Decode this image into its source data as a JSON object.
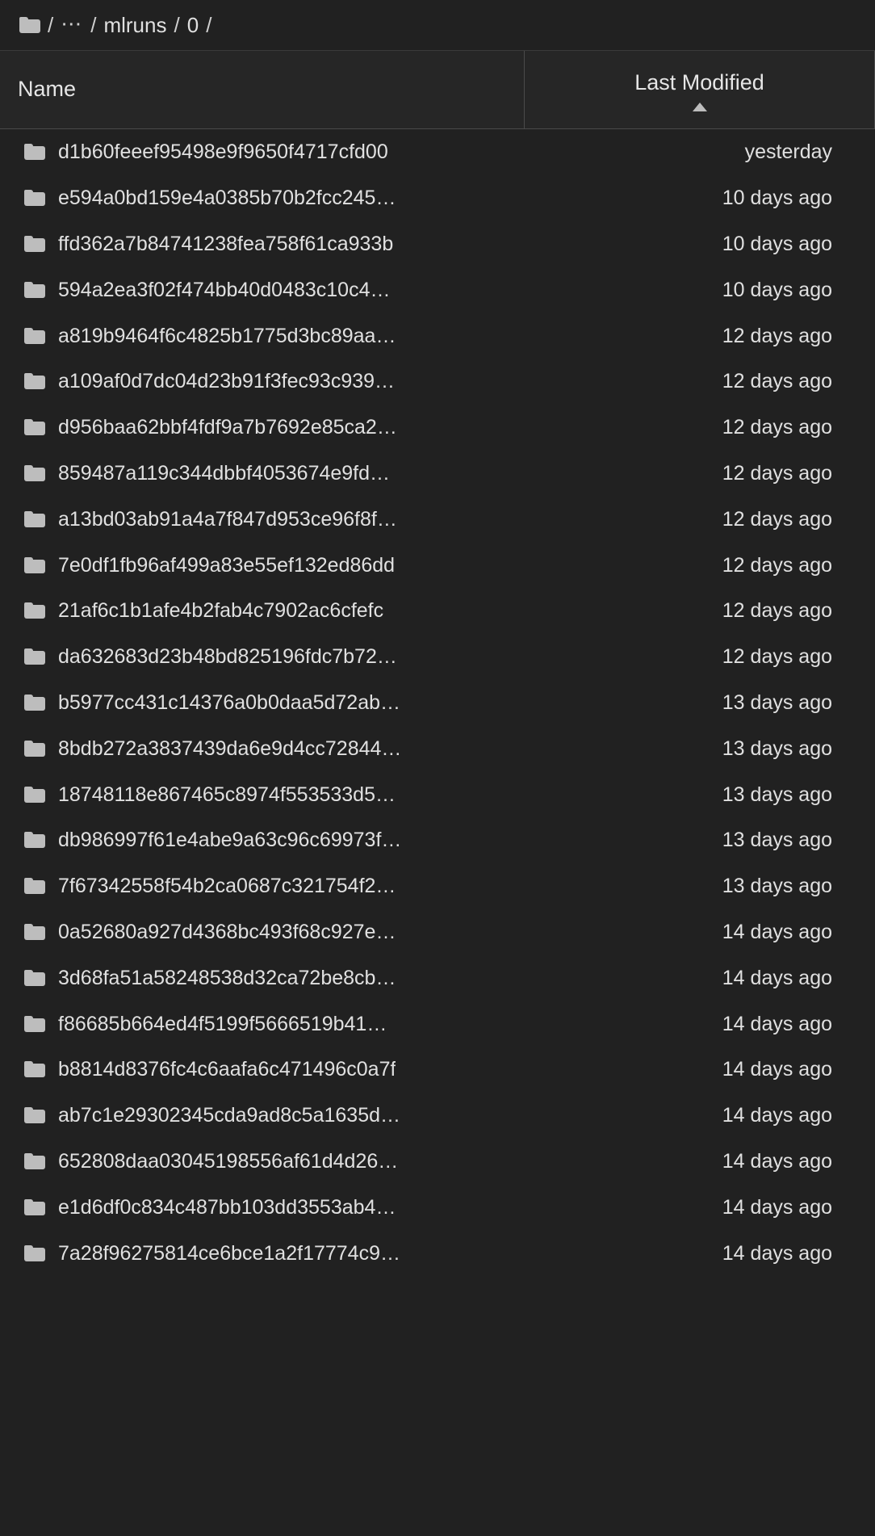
{
  "breadcrumb": {
    "root_icon": "folder-icon",
    "separator": "/",
    "ellipsis": "⋯",
    "segments": [
      "mlruns",
      "0"
    ],
    "trailing_separator": "/"
  },
  "table": {
    "columns": {
      "name": "Name",
      "last_modified": "Last Modified"
    },
    "sort": {
      "column": "Last Modified",
      "direction": "ascending",
      "indicator": "sort-ascending-icon"
    },
    "rows": [
      {
        "icon": "folder-icon",
        "name": "d1b60feeef95498e9f9650f4717cfd00",
        "last_modified": "yesterday"
      },
      {
        "icon": "folder-icon",
        "name": "e594a0bd159e4a0385b70b2fcc245…",
        "last_modified": "10 days ago"
      },
      {
        "icon": "folder-icon",
        "name": "ffd362a7b84741238fea758f61ca933b",
        "last_modified": "10 days ago"
      },
      {
        "icon": "folder-icon",
        "name": "594a2ea3f02f474bb40d0483c10c4…",
        "last_modified": "10 days ago"
      },
      {
        "icon": "folder-icon",
        "name": "a819b9464f6c4825b1775d3bc89aa…",
        "last_modified": "12 days ago"
      },
      {
        "icon": "folder-icon",
        "name": "a109af0d7dc04d23b91f3fec93c939…",
        "last_modified": "12 days ago"
      },
      {
        "icon": "folder-icon",
        "name": "d956baa62bbf4fdf9a7b7692e85ca2…",
        "last_modified": "12 days ago"
      },
      {
        "icon": "folder-icon",
        "name": "859487a119c344dbbf4053674e9fd…",
        "last_modified": "12 days ago"
      },
      {
        "icon": "folder-icon",
        "name": "a13bd03ab91a4a7f847d953ce96f8f…",
        "last_modified": "12 days ago"
      },
      {
        "icon": "folder-icon",
        "name": "7e0df1fb96af499a83e55ef132ed86dd",
        "last_modified": "12 days ago"
      },
      {
        "icon": "folder-icon",
        "name": "21af6c1b1afe4b2fab4c7902ac6cfefc",
        "last_modified": "12 days ago"
      },
      {
        "icon": "folder-icon",
        "name": "da632683d23b48bd825196fdc7b72…",
        "last_modified": "12 days ago"
      },
      {
        "icon": "folder-icon",
        "name": "b5977cc431c14376a0b0daa5d72ab…",
        "last_modified": "13 days ago"
      },
      {
        "icon": "folder-icon",
        "name": "8bdb272a3837439da6e9d4cc72844…",
        "last_modified": "13 days ago"
      },
      {
        "icon": "folder-icon",
        "name": "18748118e867465c8974f553533d5…",
        "last_modified": "13 days ago"
      },
      {
        "icon": "folder-icon",
        "name": "db986997f61e4abe9a63c96c69973f…",
        "last_modified": "13 days ago"
      },
      {
        "icon": "folder-icon",
        "name": "7f67342558f54b2ca0687c321754f2…",
        "last_modified": "13 days ago"
      },
      {
        "icon": "folder-icon",
        "name": "0a52680a927d4368bc493f68c927e…",
        "last_modified": "14 days ago"
      },
      {
        "icon": "folder-icon",
        "name": "3d68fa51a58248538d32ca72be8cb…",
        "last_modified": "14 days ago"
      },
      {
        "icon": "folder-icon",
        "name": "f86685b664ed4f5199f5666519b41…",
        "last_modified": "14 days ago"
      },
      {
        "icon": "folder-icon",
        "name": "b8814d8376fc4c6aafa6c471496c0a7f",
        "last_modified": "14 days ago"
      },
      {
        "icon": "folder-icon",
        "name": "ab7c1e29302345cda9ad8c5a1635d…",
        "last_modified": "14 days ago"
      },
      {
        "icon": "folder-icon",
        "name": "652808daa03045198556af61d4d26…",
        "last_modified": "14 days ago"
      },
      {
        "icon": "folder-icon",
        "name": "e1d6df0c834c487bb103dd3553ab4…",
        "last_modified": "14 days ago"
      },
      {
        "icon": "folder-icon",
        "name": "7a28f96275814ce6bce1a2f17774c9…",
        "last_modified": "14 days ago"
      }
    ]
  },
  "colors": {
    "background": "#212121",
    "header_background": "#262626",
    "text": "#e0e0e0",
    "icon": "#bdbdbd",
    "divider": "#4a4a4a"
  }
}
